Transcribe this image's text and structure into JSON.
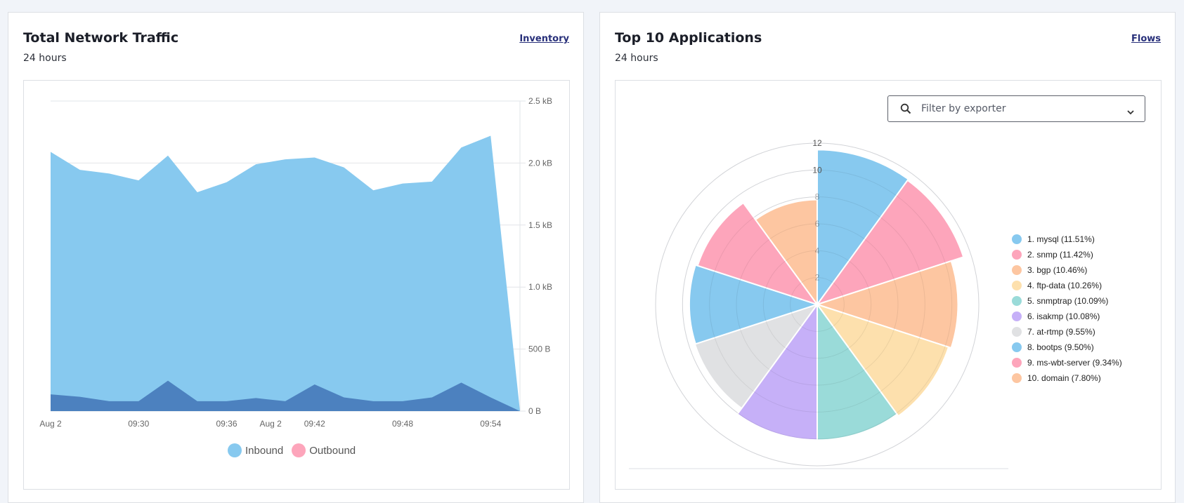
{
  "left_card": {
    "title": "Total Network Traffic",
    "subtitle": "24 hours",
    "link": "Inventory"
  },
  "right_card": {
    "title": "Top 10 Applications",
    "subtitle": "24 hours",
    "link": "Flows",
    "filter": {
      "placeholder": "Filter by exporter",
      "icon": "search-icon",
      "dropdown_icon": "chevron-down-icon"
    }
  },
  "colors": {
    "inbound": "#87c9ef",
    "outbound": "#fda5bb",
    "overlap": "#8fa4cc",
    "link": "#28307a"
  },
  "chart_data": [
    {
      "type": "area",
      "title": "Total Network Traffic",
      "xlabel": "",
      "ylabel": "",
      "y_unit": "B",
      "ylim": [
        0,
        2500
      ],
      "y_ticks": [
        0,
        500,
        1000,
        1500,
        2000,
        2500
      ],
      "y_tick_labels": [
        "0 B",
        "500 B",
        "1.0 kB",
        "1.5 kB",
        "2.0 kB",
        "2.5 kB"
      ],
      "y_axis_side": "right",
      "grid": true,
      "x_tick_labels": [
        "Aug 2",
        "09:30",
        "09:36",
        "Aug 2",
        "09:42",
        "09:48",
        "09:54"
      ],
      "x_tick_positions": [
        0,
        3,
        6,
        7.5,
        9,
        12,
        15
      ],
      "x_count": 17,
      "series": [
        {
          "name": "Inbound",
          "color": "#87c9ef",
          "values": [
            2090,
            1945,
            1915,
            1860,
            2060,
            1765,
            1845,
            1990,
            2030,
            2045,
            1965,
            1780,
            1835,
            1850,
            2125,
            2220,
            0
          ]
        },
        {
          "name": "Outbound",
          "color": "#fda5bb",
          "values": [
            135,
            115,
            80,
            80,
            245,
            80,
            80,
            105,
            80,
            215,
            110,
            80,
            80,
            110,
            230,
            110,
            0
          ]
        }
      ],
      "legend": "bottom-center"
    },
    {
      "type": "polar-area",
      "title": "Top 10 Applications",
      "r_ticks": [
        2,
        4,
        6,
        8,
        10,
        12
      ],
      "rlim": [
        0,
        12
      ],
      "legend": "right",
      "categories": [
        "1. mysql (11.51%)",
        "2. snmp (11.42%)",
        "3. bgp (10.46%)",
        "4. ftp-data (10.26%)",
        "5. snmptrap (10.09%)",
        "6. isakmp (10.08%)",
        "7. at-rtmp (9.55%)",
        "8. bootps (9.50%)",
        "9. ms-wbt-server (9.34%)",
        "10. domain (7.80%)"
      ],
      "values": [
        11.51,
        11.42,
        10.46,
        10.26,
        10.09,
        10.08,
        9.55,
        9.5,
        9.34,
        7.8
      ],
      "colors": [
        "#87c9ef",
        "#fda5bb",
        "#fdc6a1",
        "#fde0ad",
        "#9adbd9",
        "#c6b0f8",
        "#e0e1e3",
        "#87c9ef",
        "#fda5bb",
        "#fdc6a1"
      ]
    }
  ]
}
